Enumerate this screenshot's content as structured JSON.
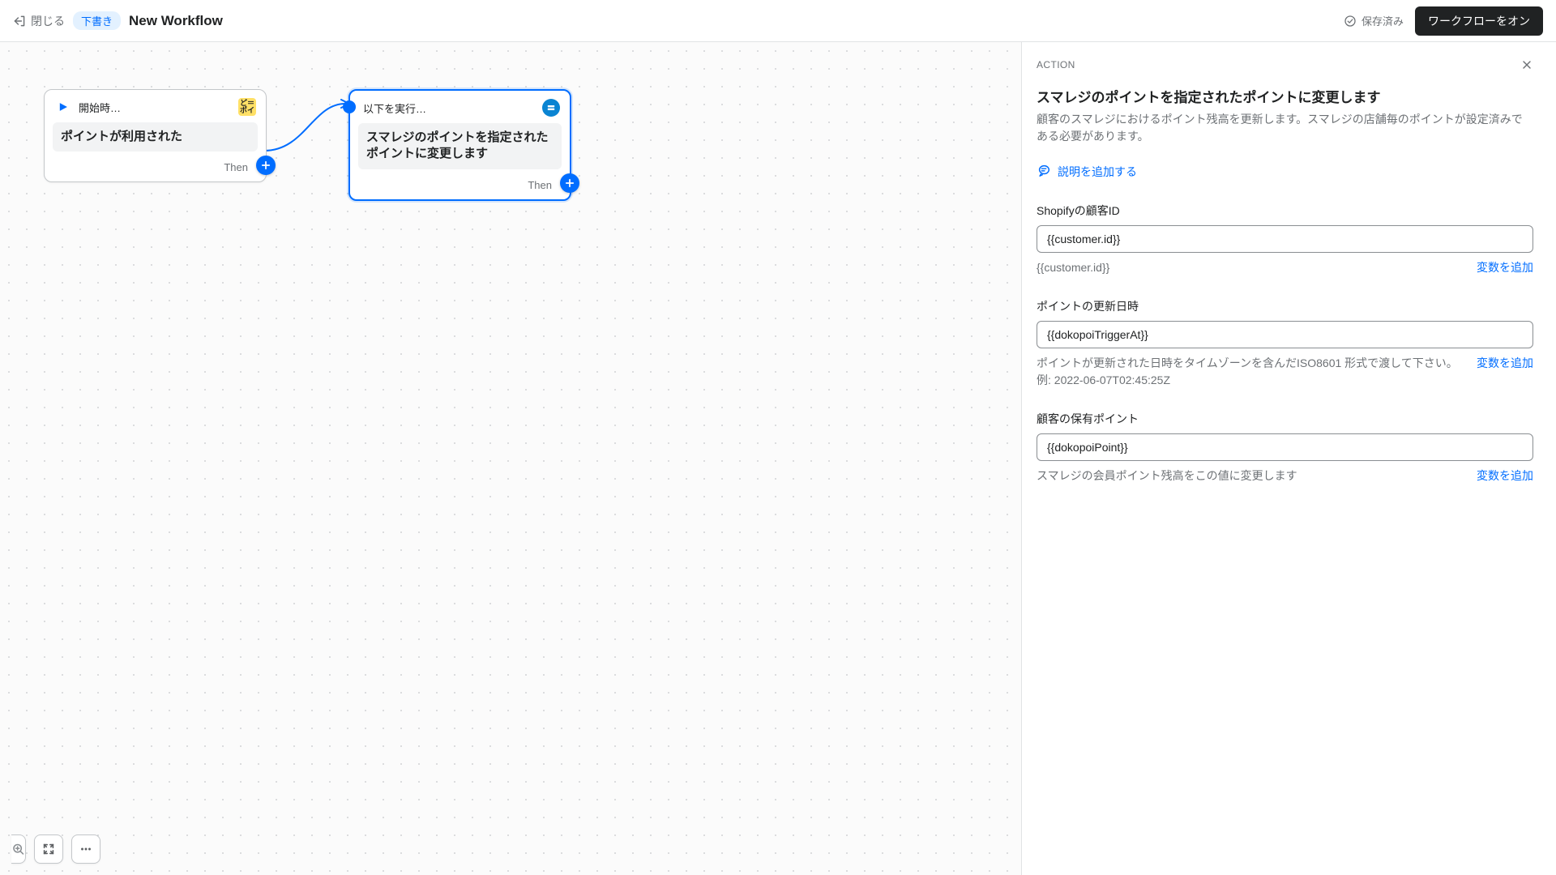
{
  "topbar": {
    "close_label": "閉じる",
    "draft_badge": "下書き",
    "title": "New Workflow",
    "saved_label": "保存済み",
    "activate_label": "ワークフローをオン"
  },
  "canvas": {
    "trigger_node": {
      "header": "開始時…",
      "badge_text": "ど＝\nポイ",
      "body": "ポイントが利用された",
      "then_label": "Then"
    },
    "action_node": {
      "header": "以下を実行…",
      "body": "スマレジのポイントを指定されたポイントに変更します",
      "then_label": "Then"
    }
  },
  "panel": {
    "section_label": "ACTION",
    "title": "スマレジのポイントを指定されたポイントに変更します",
    "description": "顧客のスマレジにおけるポイント残高を更新します。スマレジの店舗毎のポイントが設定済みである必要があります。",
    "add_description_label": "説明を追加する",
    "fields": {
      "customer_id": {
        "label": "Shopifyの顧客ID",
        "value": "{{customer.id}}",
        "help": "{{customer.id}}",
        "add_var": "変数を追加"
      },
      "updated_at": {
        "label": "ポイントの更新日時",
        "value": "{{dokopoiTriggerAt}}",
        "help": "ポイントが更新された日時をタイムゾーンを含んだISO8601 形式で渡して下さい。例: 2022-06-07T02:45:25Z",
        "add_var": "変数を追加"
      },
      "points": {
        "label": "顧客の保有ポイント",
        "value": "{{dokopoiPoint}}",
        "help": "スマレジの会員ポイント残高をこの値に変更します",
        "add_var": "変数を追加"
      }
    }
  }
}
